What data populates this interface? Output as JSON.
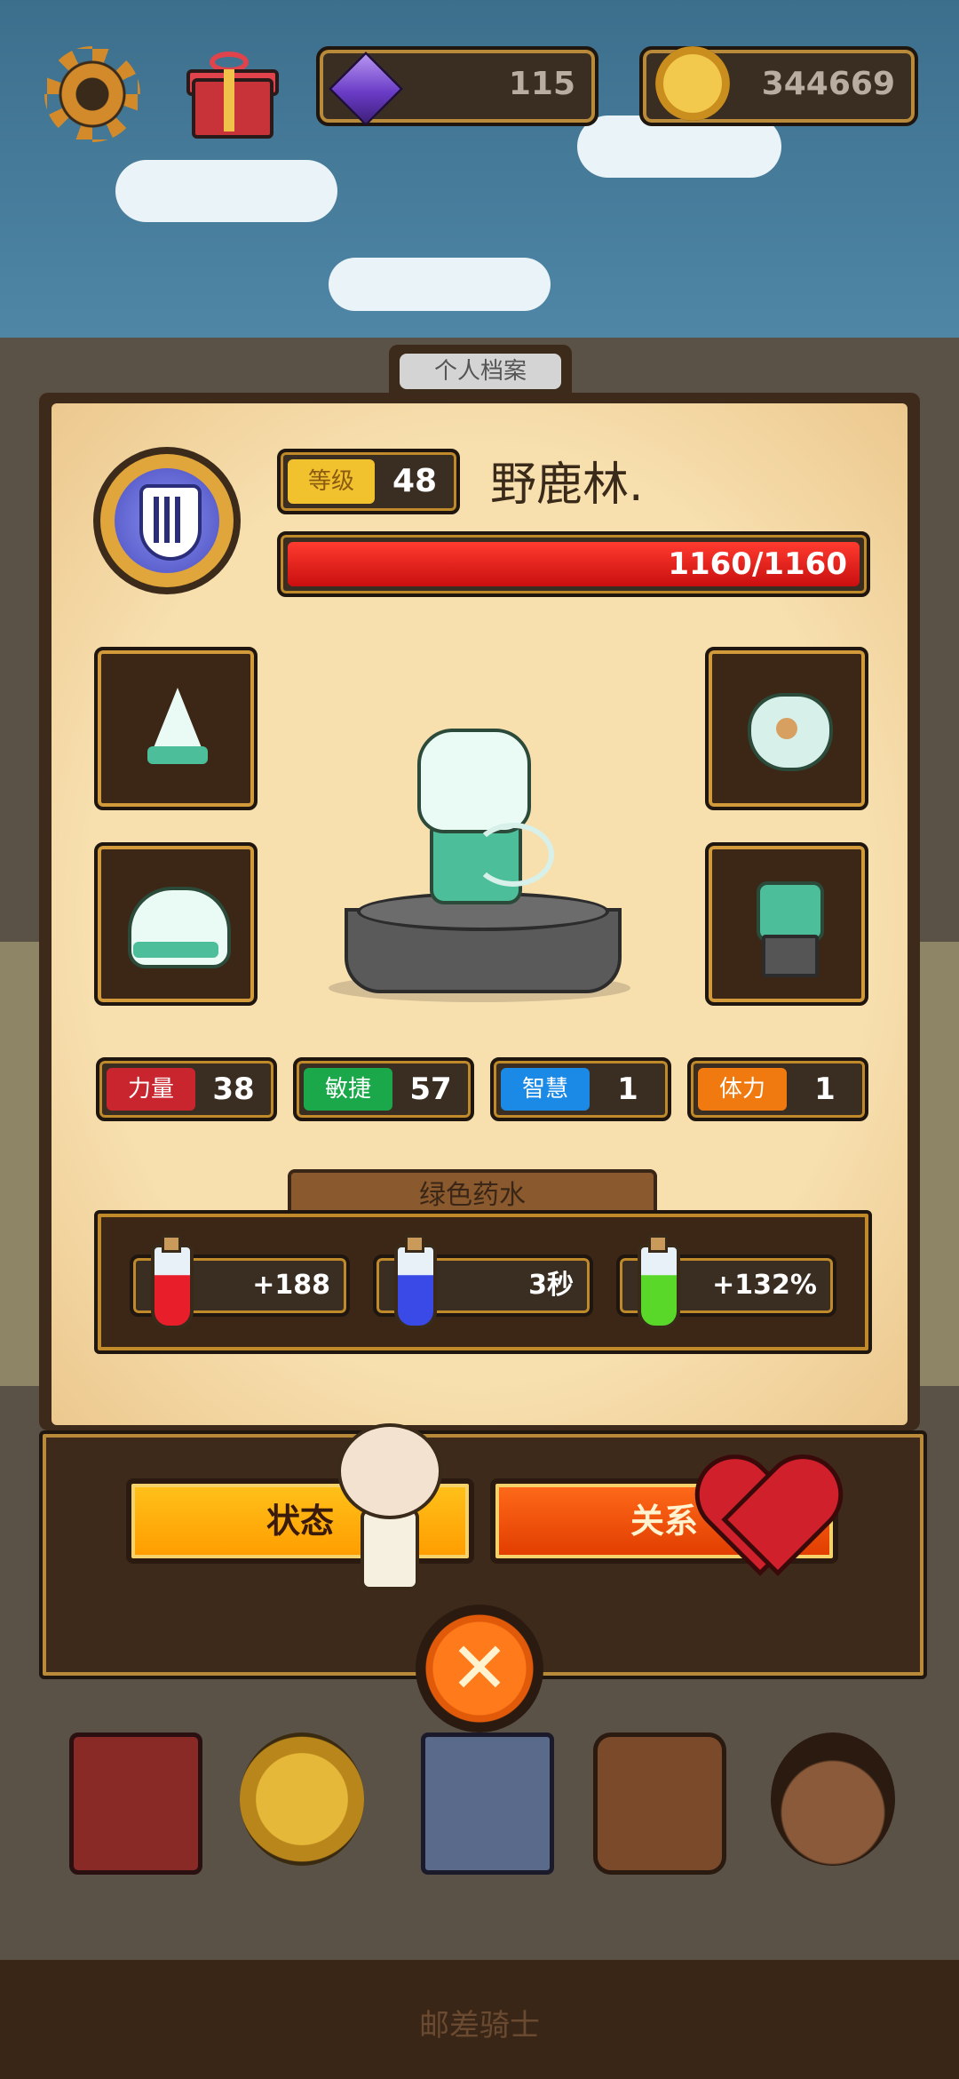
{
  "topbar": {
    "gems": "115",
    "coins": "344669",
    "icons": [
      "gear-icon",
      "gift-icon",
      "gem-icon",
      "coin-icon"
    ]
  },
  "profile": {
    "tab_label": "个人档案",
    "level_label": "等级",
    "level": "48",
    "player_name": "野鹿林.",
    "hp_text": "1160/1160",
    "hp_fraction": 1.0
  },
  "stats": [
    {
      "label": "力量",
      "value": "38",
      "color": "#c8252e"
    },
    {
      "label": "敏捷",
      "value": "57",
      "color": "#1aa84a"
    },
    {
      "label": "智慧",
      "value": "1",
      "color": "#1a8ae6"
    },
    {
      "label": "体力",
      "value": "1",
      "color": "#f07a10"
    }
  ],
  "potions": {
    "title": "绿色药水",
    "items": [
      {
        "value": "+188",
        "icon": "red-potion-heart-icon"
      },
      {
        "value": "3秒",
        "icon": "blue-potion-hourglass-icon"
      },
      {
        "value": "+132%",
        "icon": "green-potion-boost-icon"
      }
    ]
  },
  "buttons": {
    "status": "状态",
    "relation": "关系"
  },
  "footer": {
    "title": "邮差骑士"
  },
  "colors": {
    "hp_bar": "#e8140f",
    "status_button": "#ffae00",
    "relation_button": "#f05a0a"
  }
}
